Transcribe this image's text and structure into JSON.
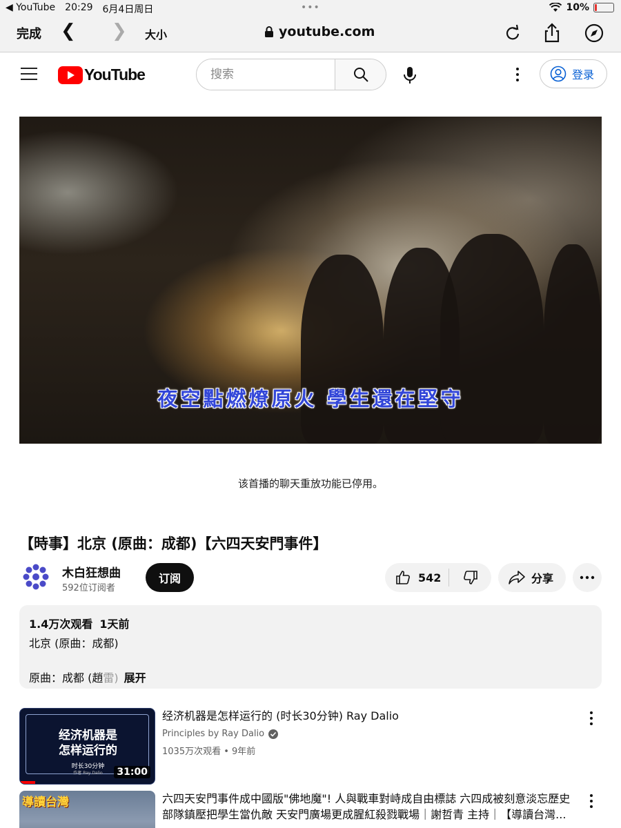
{
  "statusbar": {
    "back_app": "◀ YouTube",
    "time": "20:29",
    "date": "6月4日周日",
    "dots": "•••",
    "battery": "10%",
    "battery_level": 0.1
  },
  "safari": {
    "done": "完成",
    "text_size": "大小",
    "url": "youtube.com"
  },
  "header": {
    "logo_text": "YouTube",
    "search_placeholder": "搜索",
    "login": "登录"
  },
  "video": {
    "subtitle": "夜空點燃燎原火 學生還在堅守"
  },
  "chat_notice": "该首播的聊天重放功能已停用。",
  "title": "【時事】北京 (原曲：成都)【六四天安門事件】",
  "channel": {
    "name": "木白狂想曲",
    "subscribers": "592位订阅者",
    "subscribe_label": "订阅"
  },
  "actions": {
    "likes": "542",
    "share": "分享"
  },
  "description": {
    "views": "1.4万次观看",
    "age": "1天前",
    "line1": "北京 (原曲：成都)",
    "line2_visible": "原曲：成都 (趙",
    "line2_faded": "雷)",
    "expand": "展开"
  },
  "recommendations": [
    {
      "title": "经济机器是怎样运行的 (时长30分钟) Ray Dalio",
      "channel": "Principles by Ray Dalio",
      "meta": "1035万次观看 • 9年前",
      "duration": "31:00",
      "thumb_title": "经济机器是\n怎样运行的",
      "thumb_sub": "时长30分钟",
      "thumb_sub2": "作者 Ray Dalio"
    },
    {
      "title": "六四天安門事件成中國版\"佛地魔\"! 人與戰車對峙成自由標誌 六四成被刻意淡忘歷史 部隊鎮壓把學生當仇敵 天安門廣場更成腥紅殺戮戰場｜謝哲青 主持｜【導讀台灣...",
      "thumb_tag": "導讀台灣"
    }
  ]
}
